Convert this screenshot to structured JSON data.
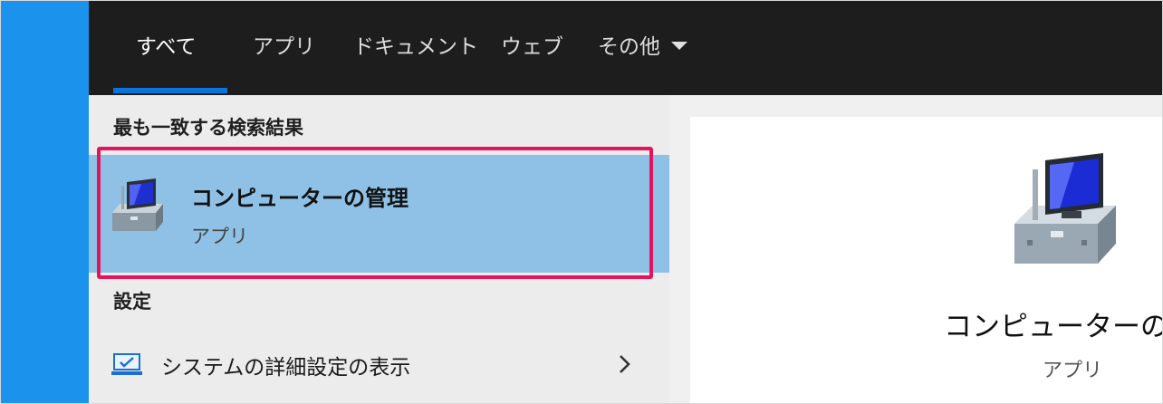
{
  "nav": {
    "tabs": [
      {
        "label": "すべて"
      },
      {
        "label": "アプリ"
      },
      {
        "label": "ドキュメント"
      },
      {
        "label": "ウェブ"
      },
      {
        "label": "その他"
      }
    ],
    "more_icon": "chevron-down-icon"
  },
  "results": {
    "best_match_heading": "最も一致する検索結果",
    "best_match": {
      "title": "コンピューターの管理",
      "subtitle": "アプリ",
      "icon": "computer-management-icon"
    },
    "settings_heading": "設定",
    "settings_items": [
      {
        "label": "システムの詳細設定の表示",
        "icon": "monitor-icon",
        "arrow_icon": "chevron-right-icon"
      }
    ]
  },
  "preview": {
    "title": "コンピューターの管",
    "subtitle": "アプリ",
    "icon": "computer-management-icon"
  },
  "colors": {
    "accent": "#0a74da",
    "selection": "#8fc1e6",
    "highlight_border": "#e5135b",
    "nav_bg": "#1d1d1d"
  }
}
